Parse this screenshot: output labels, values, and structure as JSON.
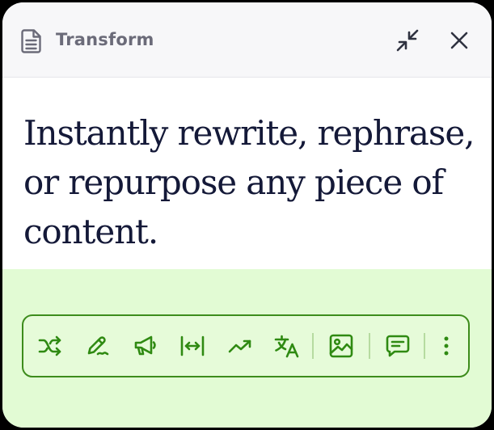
{
  "window": {
    "title": "Transform",
    "icons": {
      "title_icon": "document-icon",
      "minimize": "minimize-arrows-icon",
      "close": "close-icon"
    }
  },
  "main": {
    "headline": "Instantly rewrite, rephrase, or repurpose any piece of content."
  },
  "toolbar": {
    "tools": [
      {
        "icon": "shuffle-icon"
      },
      {
        "icon": "pen-icon"
      },
      {
        "icon": "megaphone-icon"
      },
      {
        "icon": "expand-width-icon"
      },
      {
        "icon": "trending-up-icon"
      },
      {
        "icon": "translate-icon"
      },
      {
        "icon": "image-icon"
      },
      {
        "icon": "comment-icon"
      },
      {
        "icon": "more-vertical-icon"
      }
    ]
  },
  "colors": {
    "accent": "#2f8a12",
    "footer_bg": "#e2fbd4",
    "headline": "#141938",
    "header_text": "#6b6b79"
  }
}
